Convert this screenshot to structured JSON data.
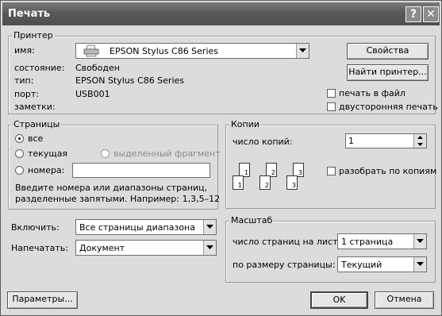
{
  "window": {
    "title": "Печать"
  },
  "title_buttons": {
    "help": "?",
    "close": "✕"
  },
  "printer": {
    "group_label": "Принтер",
    "name_label": "имя:",
    "name_value": "EPSON Stylus C86 Series",
    "state_label": "состояние:",
    "state_value": "Свободен",
    "type_label": "тип:",
    "type_value": "EPSON Stylus C86 Series",
    "port_label": "порт:",
    "port_value": "USB001",
    "notes_label": "заметки:",
    "properties_button": "Свойства",
    "find_printer_button": "Найти принтер...",
    "print_to_file_label": "печать в файл",
    "print_to_file_checked": false,
    "duplex_label": "двусторонняя печать",
    "duplex_checked": false
  },
  "pages": {
    "group_label": "Страницы",
    "options": [
      {
        "label": "все",
        "selected": true
      },
      {
        "label": "текущая",
        "selected": false
      },
      {
        "label": "выделенный фрагмент",
        "selected": false,
        "disabled": true
      },
      {
        "label": "номера:",
        "selected": false
      }
    ],
    "numbers_value": "",
    "hint": [
      "Введите номера или диапазоны страниц,",
      "разделенные запятыми. Например: 1,3,5–12"
    ]
  },
  "copies": {
    "group_label": "Копии",
    "count_label": "число копий:",
    "count_value": "1",
    "collate_label": "разобрать по копиям",
    "collate_checked": false,
    "collate_pages": [
      "1",
      "1",
      "2",
      "2",
      "3",
      "3"
    ]
  },
  "include": {
    "label": "Включить:",
    "value": "Все страницы диапазона"
  },
  "print_what": {
    "label": "Напечатать:",
    "value": "Документ"
  },
  "zoom": {
    "group_label": "Масштаб",
    "pages_per_sheet_label": "число страниц на листе:",
    "pages_per_sheet_value": "1 страница",
    "scale_to_paper_label": "по размеру страницы:",
    "scale_to_paper_value": "Текущий"
  },
  "footer": {
    "options_button": "Параметры...",
    "ok_button": "OK",
    "cancel_button": "Отмена"
  },
  "icons": {
    "printer": "printer-icon",
    "dropdown": "chevron-down-icon",
    "spin_up": "spin-up-icon",
    "spin_down": "spin-down-icon"
  }
}
